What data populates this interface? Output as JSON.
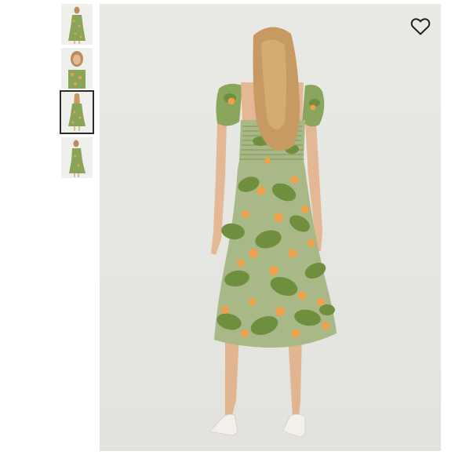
{
  "gallery": {
    "thumbnails": [
      {
        "view": "front",
        "selected": false
      },
      {
        "view": "front-closeup",
        "selected": false
      },
      {
        "view": "back",
        "selected": true
      },
      {
        "view": "side",
        "selected": false
      }
    ],
    "main_image": {
      "view": "back"
    },
    "favorite_icon": "heart-outline-icon"
  },
  "colors": {
    "background": "#ffffff",
    "photo_bg": "#e6e6e2",
    "dress_green": "#7a9a4a",
    "dress_light": "#cfd6b6",
    "orange": "#eea04a",
    "skin": "#e4b894",
    "hair": "#c69a62",
    "selected_border": "#2b2b2b"
  }
}
